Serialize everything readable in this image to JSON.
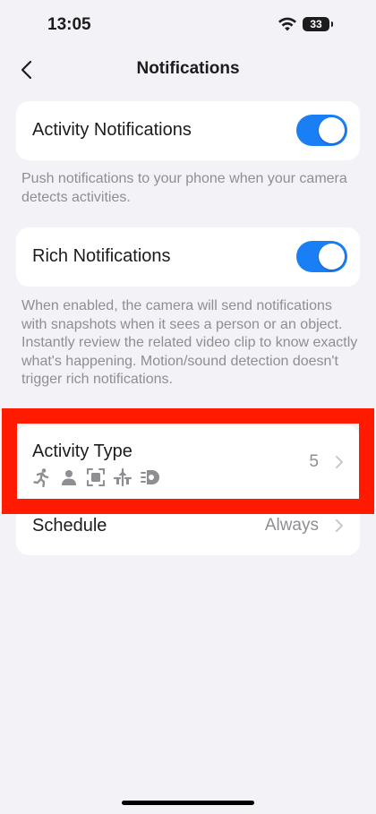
{
  "status_bar": {
    "time": "13:05",
    "battery": "33"
  },
  "nav": {
    "title": "Notifications"
  },
  "activity_notifications": {
    "label": "Activity Notifications",
    "enabled": true,
    "help": "Push notifications to your phone when your camera detects activities."
  },
  "rich_notifications": {
    "label": "Rich Notifications",
    "enabled": true,
    "help": "When enabled, the camera will send notifications with snapshots when it sees a person or an object. Instantly review the related video clip to know exactly what's happening. Motion/sound detection doesn't trigger rich notifications."
  },
  "activity_type": {
    "label": "Activity Type",
    "count": "5",
    "icons": [
      "motion-icon",
      "person-icon",
      "object-icon",
      "line-crossing-icon",
      "sound-icon"
    ]
  },
  "schedule": {
    "label": "Schedule",
    "value": "Always"
  },
  "colors": {
    "accent": "#1a7ef5",
    "highlight": "#ff1a00"
  }
}
